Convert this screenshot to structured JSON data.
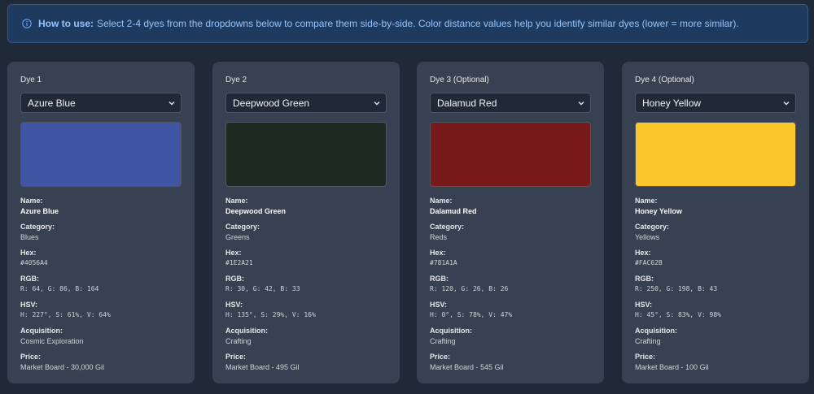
{
  "banner": {
    "icon": "info-circle-icon",
    "bold": "How to use:",
    "text": "Select 2-4 dyes from the dropdowns below to compare them side-by-side. Color distance values help you identify similar dyes (lower = more similar)."
  },
  "field_labels": {
    "name": "Name:",
    "category": "Category:",
    "hex": "Hex:",
    "rgb": "RGB:",
    "hsv": "HSV:",
    "acquisition": "Acquisition:",
    "price": "Price:"
  },
  "cards": [
    {
      "label": "Dye 1",
      "selected": "Azure Blue",
      "swatch_color": "#4056A4",
      "name": "Azure Blue",
      "category": "Blues",
      "hex": "#4056A4",
      "rgb": "R: 64, G: 86, B: 164",
      "hsv": "H: 227°, S: 61%, V: 64%",
      "acquisition": "Cosmic Exploration",
      "price": "Market Board - 30,000 Gil"
    },
    {
      "label": "Dye 2",
      "selected": "Deepwood Green",
      "swatch_color": "#1E2A21",
      "name": "Deepwood Green",
      "category": "Greens",
      "hex": "#1E2A21",
      "rgb": "R: 30, G: 42, B: 33",
      "hsv": "H: 135°, S: 29%, V: 16%",
      "acquisition": "Crafting",
      "price": "Market Board - 495 Gil"
    },
    {
      "label": "Dye 3 (Optional)",
      "selected": "Dalamud Red",
      "swatch_color": "#781A1A",
      "name": "Dalamud Red",
      "category": "Reds",
      "hex": "#781A1A",
      "rgb": "R: 120, G: 26, B: 26",
      "hsv": "H: 0°, S: 78%, V: 47%",
      "acquisition": "Crafting",
      "price": "Market Board - 545 Gil"
    },
    {
      "label": "Dye 4 (Optional)",
      "selected": "Honey Yellow",
      "swatch_color": "#FAC62B",
      "name": "Honey Yellow",
      "category": "Yellows",
      "hex": "#FAC62B",
      "rgb": "R: 250, G: 198, B: 43",
      "hsv": "H: 45°, S: 83%, V: 98%",
      "acquisition": "Crafting",
      "price": "Market Board - 100 Gil"
    }
  ]
}
